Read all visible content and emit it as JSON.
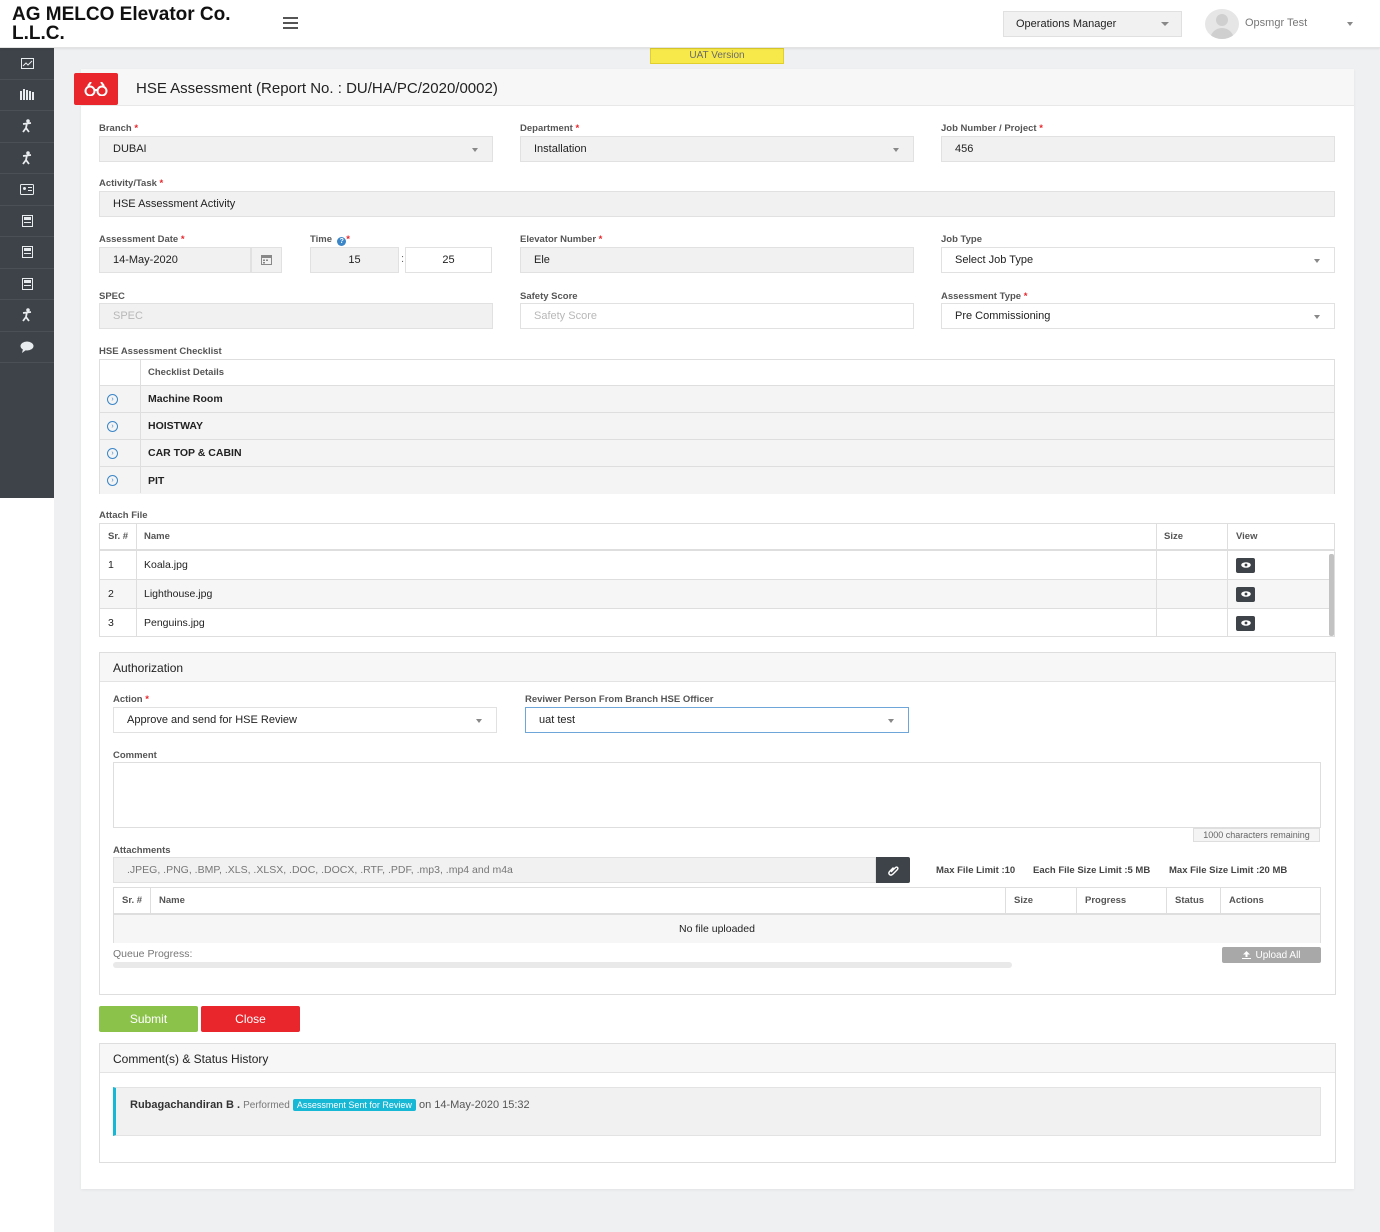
{
  "header": {
    "brand": "AG MELCO Elevator Co. L.L.C.",
    "role": "Operations Manager",
    "username": "Opsmgr Test"
  },
  "uat_label": "UAT Version",
  "sidebar": {
    "icons": [
      "dashboard-icon",
      "library-icon",
      "worker-icon",
      "worker-icon",
      "id-card-icon",
      "form-icon",
      "form-icon",
      "form-icon",
      "worker-icon",
      "chat-icon"
    ]
  },
  "page": {
    "title": "HSE Assessment (Report No. : DU/HA/PC/2020/0002)"
  },
  "form": {
    "branch_label": "Branch",
    "branch_value": "DUBAI",
    "department_label": "Department",
    "department_value": "Installation",
    "job_label": "Job Number / Project",
    "job_value": "456",
    "activity_label": "Activity/Task",
    "activity_value": "HSE Assessment Activity",
    "date_label": "Assessment Date",
    "date_value": "14-May-2020",
    "time_label": "Time",
    "time_hour": "15",
    "time_min": "25",
    "time_sep": ":",
    "elevator_label": "Elevator Number",
    "elevator_value": "Ele",
    "jobtype_label": "Job Type",
    "jobtype_value": "Select Job Type",
    "spec_label": "SPEC",
    "spec_placeholder": "SPEC",
    "safety_label": "Safety Score",
    "safety_placeholder": "Safety Score",
    "atype_label": "Assessment Type",
    "atype_value": "Pre Commissioning",
    "required_mark": "*"
  },
  "checklist": {
    "label": "HSE Assessment Checklist",
    "header": "Checklist Details",
    "items": [
      "Machine Room",
      "HOISTWAY",
      "CAR TOP & CABIN",
      "PIT"
    ]
  },
  "attach": {
    "label": "Attach File",
    "headers": {
      "sr": "Sr. #",
      "name": "Name",
      "size": "Size",
      "view": "View"
    },
    "rows": [
      {
        "sr": "1",
        "name": "Koala.jpg",
        "size": ""
      },
      {
        "sr": "2",
        "name": "Lighthouse.jpg",
        "size": ""
      },
      {
        "sr": "3",
        "name": "Penguins.jpg",
        "size": ""
      }
    ]
  },
  "authorization": {
    "title": "Authorization",
    "action_label": "Action",
    "action_value": "Approve and send for HSE Review",
    "reviewer_label": "Reviwer Person From Branch HSE Officer",
    "reviewer_value": "uat test",
    "comment_label": "Comment",
    "chars_remaining": "1000 characters remaining",
    "attachments_label": "Attachments",
    "file_types": ".JPEG, .PNG, .BMP, .XLS, .XLSX, .DOC, .DOCX, .RTF, .PDF, .mp3, .mp4 and m4a",
    "limits": {
      "max_files": "Max File Limit :10",
      "each_size": "Each File Size Limit :5 MB",
      "max_size": "Max File Size Limit :20 MB"
    },
    "upload_headers": {
      "sr": "Sr. #",
      "name": "Name",
      "size": "Size",
      "progress": "Progress",
      "status": "Status",
      "actions": "Actions"
    },
    "no_file": "No file uploaded",
    "queue_label": "Queue Progress:",
    "upload_all": "Upload All"
  },
  "buttons": {
    "submit": "Submit",
    "close": "Close"
  },
  "history": {
    "title": "Comment(s) & Status History",
    "entry": {
      "person": "Rubagachandiran B .",
      "performed": "Performed",
      "status": "Assessment Sent for Review",
      "on": "on 14-May-2020 15:32"
    }
  },
  "colors": {
    "accent_red": "#e8262c",
    "submit_green": "#8bc34a",
    "badge_cyan": "#17b7d6",
    "sidebar": "#3d4348"
  }
}
